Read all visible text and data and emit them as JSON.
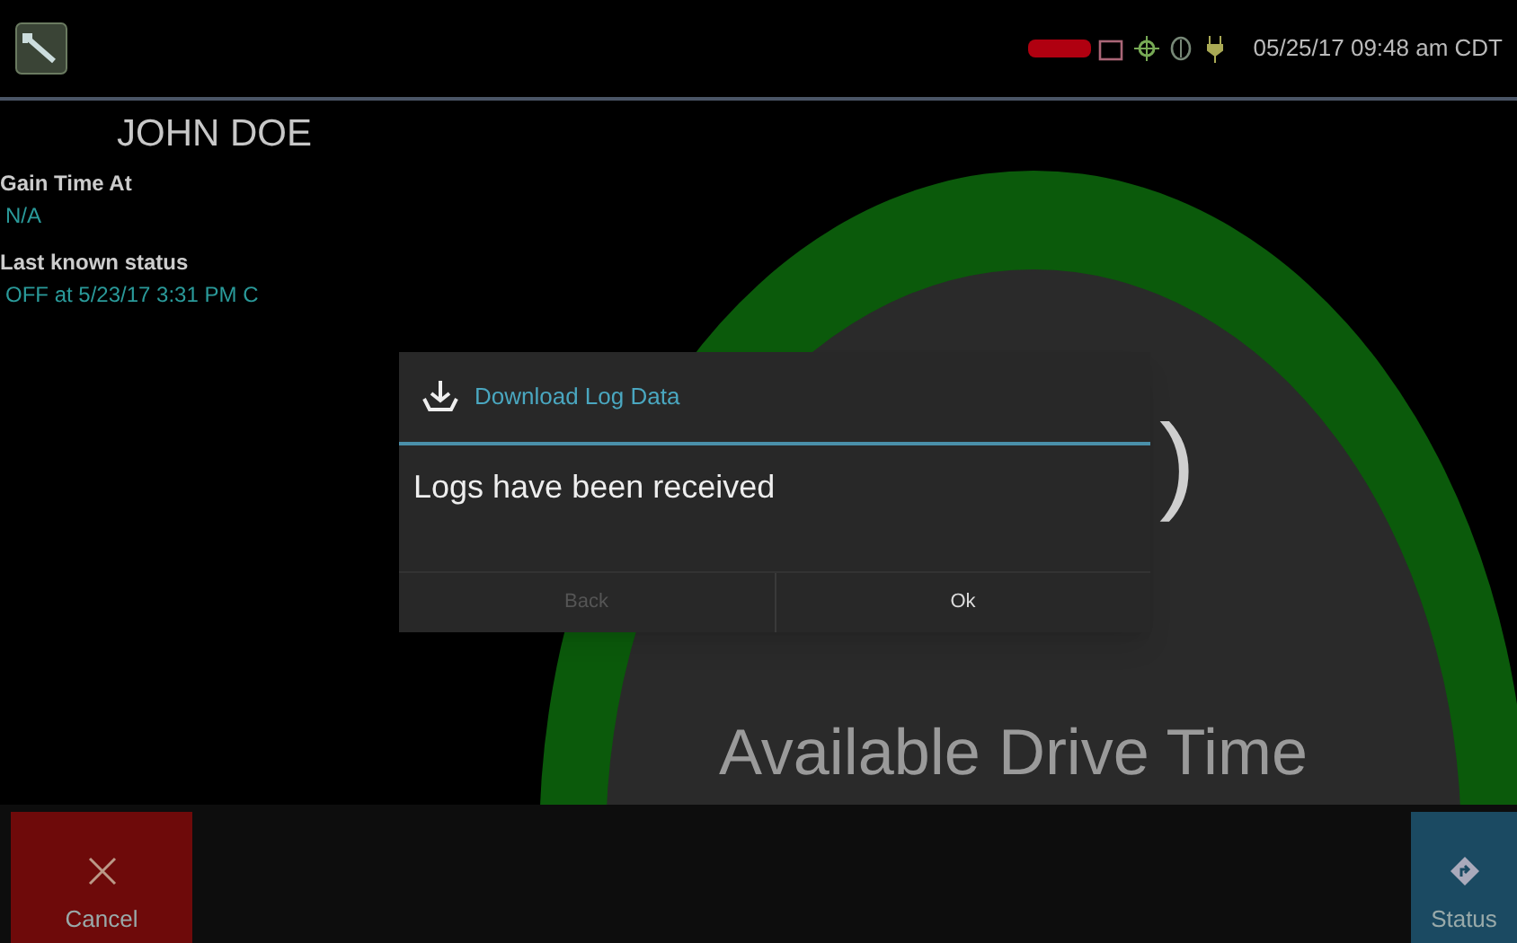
{
  "status_bar": {
    "datetime": "05/25/17 09:48 am CDT"
  },
  "driver": {
    "name": "JOHN DOE"
  },
  "fields": [
    {
      "label": "Gain Time At",
      "value": "N/A"
    },
    {
      "label": "Last known status",
      "value": "OFF at 5/23/17 3:31 PM C"
    }
  ],
  "gauge": {
    "value": ")",
    "caption": "Available Drive Time"
  },
  "dialog": {
    "title": "Download Log Data",
    "message": "Logs have been received",
    "buttons": [
      {
        "label": "Back",
        "disabled": true
      },
      {
        "label": "Ok",
        "disabled": false
      }
    ]
  },
  "bottom_bar": [
    {
      "label": "Cancel",
      "kind": "cancel"
    },
    {
      "label": "Status",
      "kind": "status"
    }
  ]
}
